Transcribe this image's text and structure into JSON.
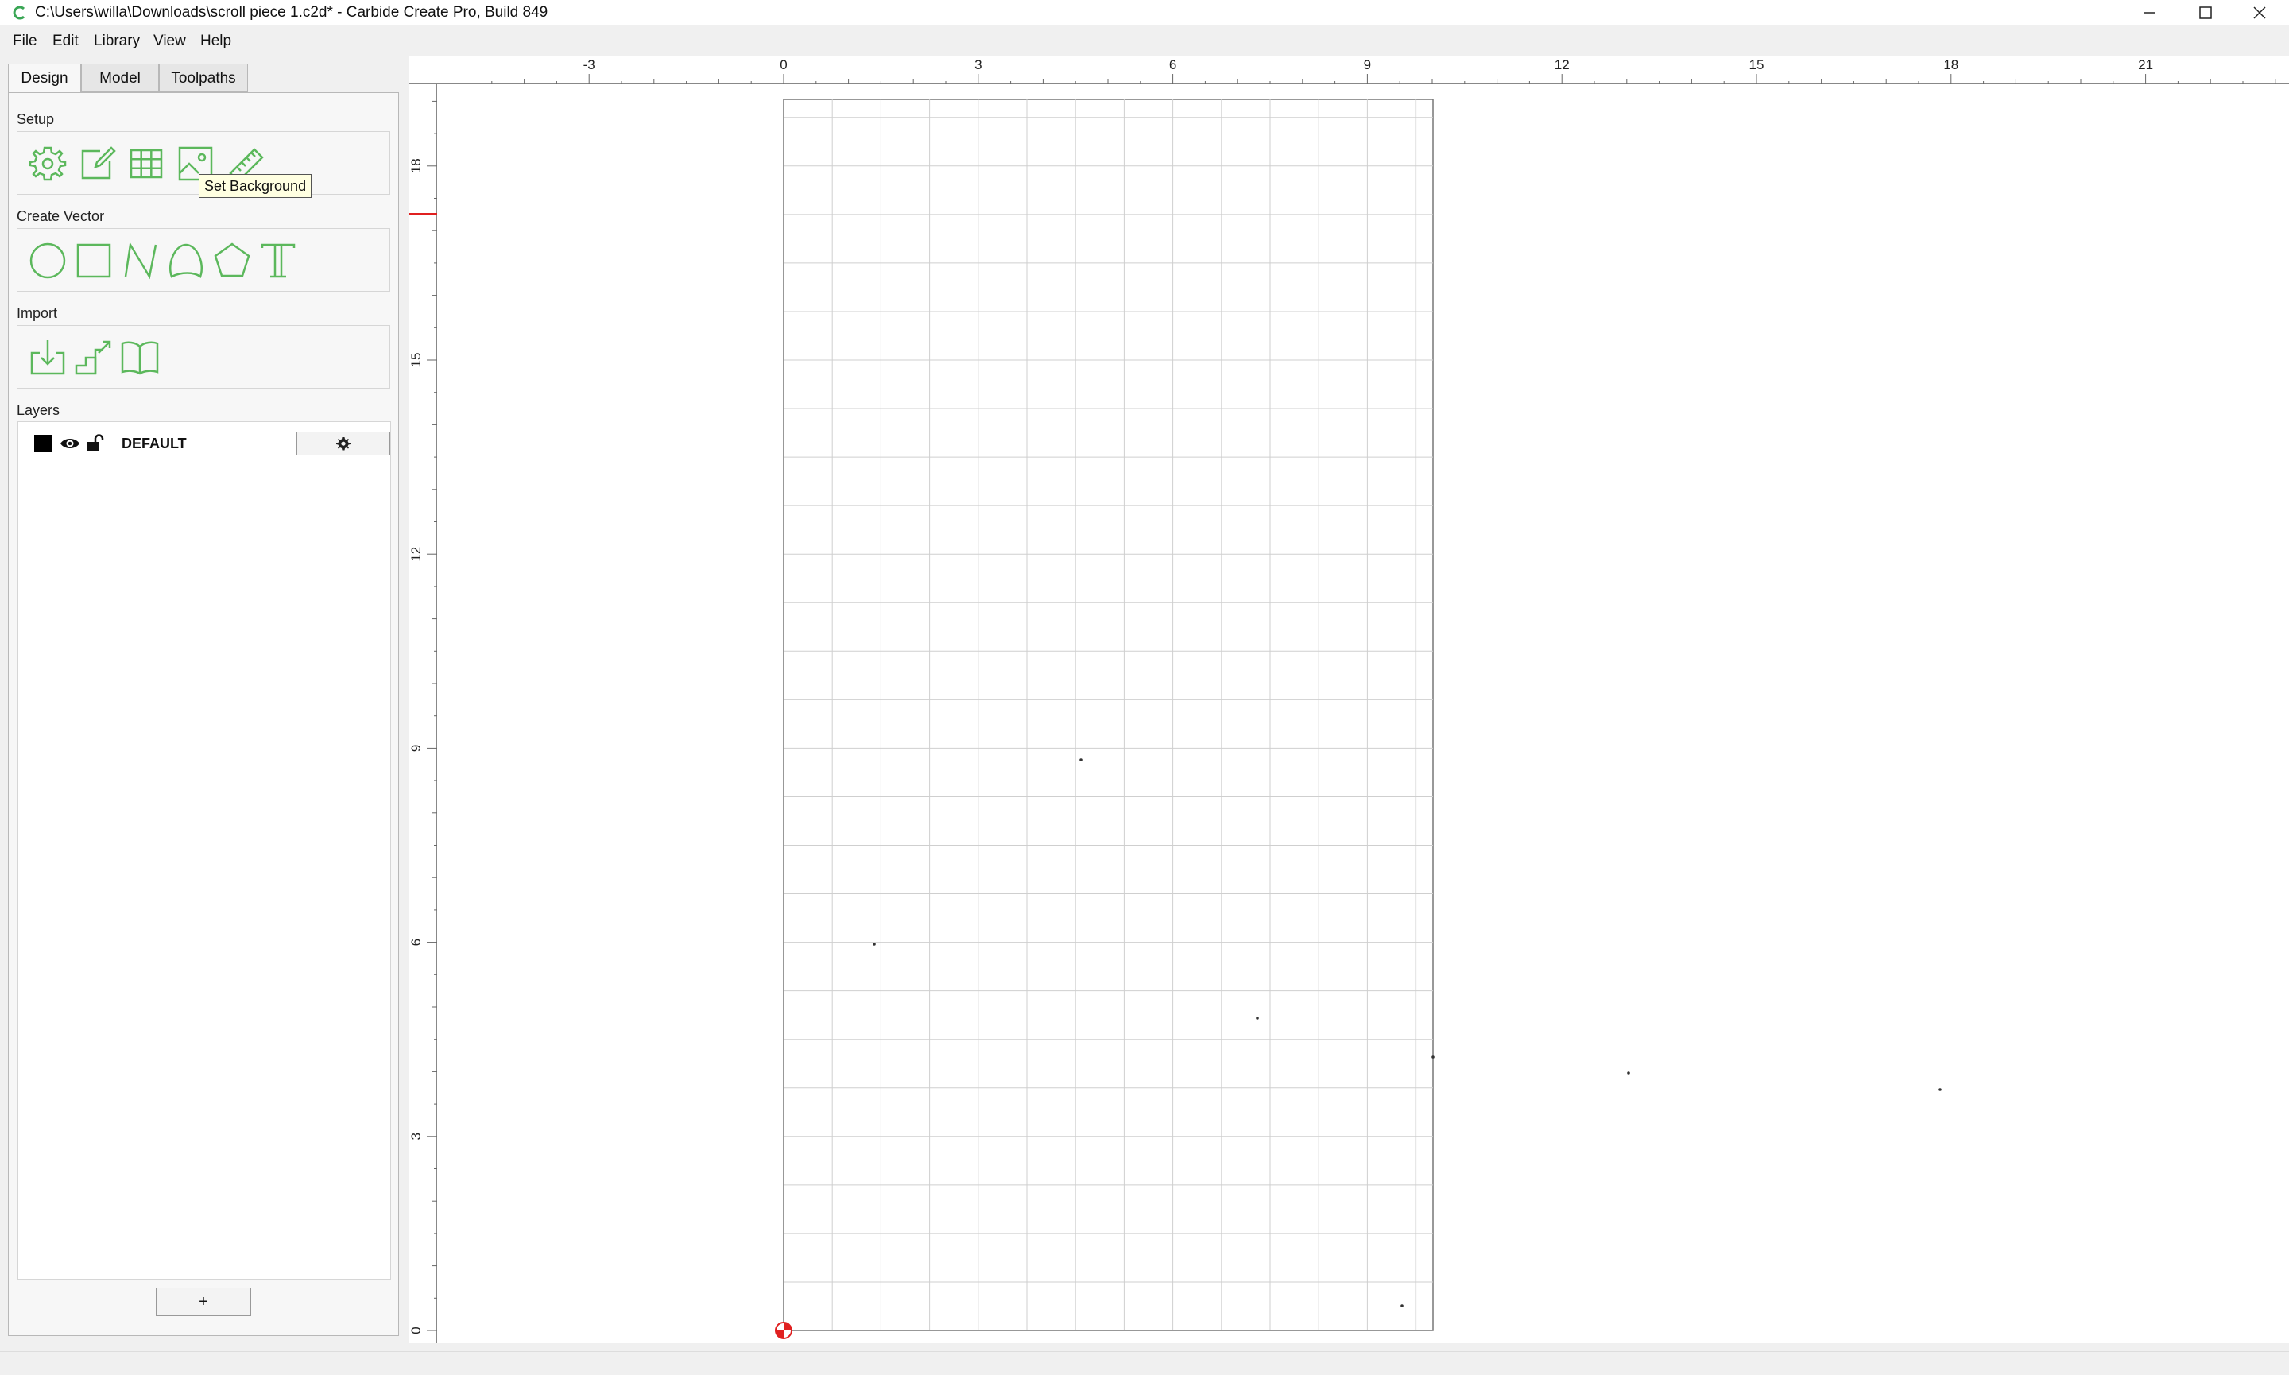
{
  "window": {
    "title": "C:\\Users\\willa\\Downloads\\scroll piece 1.c2d* - Carbide Create Pro, Build 849",
    "minimize_label": "—",
    "maximize_label": "□",
    "close_label": "✕"
  },
  "menu": [
    {
      "label": "File"
    },
    {
      "label": "Edit"
    },
    {
      "label": "Library"
    },
    {
      "label": "View"
    },
    {
      "label": "Help"
    }
  ],
  "tabs": [
    {
      "label": "Design",
      "active": true
    },
    {
      "label": "Model",
      "active": false
    },
    {
      "label": "Toolpaths",
      "active": false
    }
  ],
  "sections": {
    "setup": "Setup",
    "create_vector": "Create Vector",
    "import": "Import",
    "layers": "Layers"
  },
  "setup_tools": [
    "gear-icon",
    "edit-job-icon",
    "grid-icon",
    "image-icon",
    "ruler-icon"
  ],
  "vector_tools": [
    "circle-icon",
    "rectangle-icon",
    "polyline-icon",
    "curve-icon",
    "polygon-icon",
    "text-icon"
  ],
  "import_tools": [
    "import-icon",
    "import-stairs-icon",
    "book-icon"
  ],
  "tooltip": "Set Background",
  "layers": [
    {
      "name": "DEFAULT",
      "color": "#000000",
      "visible": true,
      "locked": false
    }
  ],
  "add_layer_label": "+",
  "ruler": {
    "top_labels": [
      "-3",
      "0",
      "3",
      "6",
      "9",
      "12",
      "15",
      "18",
      "21"
    ],
    "left_labels": [
      "18",
      "15",
      "12",
      "9",
      "6",
      "3",
      "0"
    ]
  },
  "colors": {
    "accent_green": "#5cb85c",
    "origin_red": "#e02020",
    "grid": "#cfcfcf"
  }
}
